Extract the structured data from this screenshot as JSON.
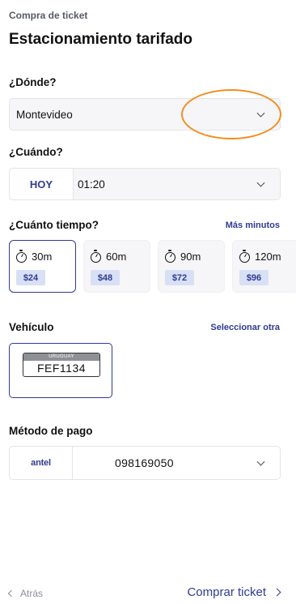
{
  "header": {
    "breadcrumb": "Compra de ticket",
    "title": "Estacionamiento tarifado"
  },
  "where": {
    "label": "¿Dónde?",
    "value": "Montevideo"
  },
  "when": {
    "label": "¿Cuándo?",
    "today_label": "HOY",
    "time_value": "01:20"
  },
  "duration": {
    "label": "¿Cuánto tiempo?",
    "more_link": "Más minutos",
    "options": [
      {
        "time": "30m",
        "price": "$24",
        "selected": true
      },
      {
        "time": "60m",
        "price": "$48",
        "selected": false
      },
      {
        "time": "90m",
        "price": "$72",
        "selected": false
      },
      {
        "time": "120m",
        "price": "$96",
        "selected": false
      }
    ]
  },
  "vehicle": {
    "label": "Vehículo",
    "select_link": "Seleccionar otra",
    "plate_country": "URUGUAY",
    "plate_number": "FEF1134"
  },
  "payment": {
    "label": "Método de pago",
    "brand": "antel",
    "number": "098169050"
  },
  "footer": {
    "back_label": "Atrás",
    "buy_label": "Comprar ticket"
  },
  "colors": {
    "accent": "#2f3b93",
    "highlight_ring": "#f38d1e",
    "price_badge_bg": "#d8e0f6"
  }
}
